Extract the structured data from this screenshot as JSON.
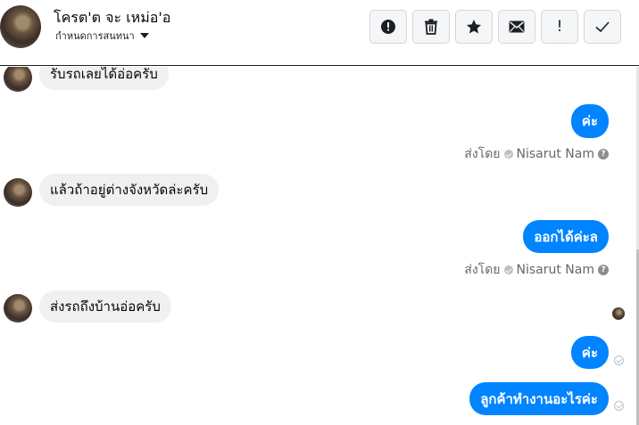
{
  "header": {
    "name": "โครต'ต จะ เหม่อ'อ",
    "subtitle": "กำหนดการสนทนา"
  },
  "toolbar": {
    "buttons": [
      {
        "name": "report-button",
        "icon": "alert-circle-icon"
      },
      {
        "name": "delete-button",
        "icon": "trash-icon"
      },
      {
        "name": "star-button",
        "icon": "star-icon"
      },
      {
        "name": "mail-button",
        "icon": "envelope-icon"
      },
      {
        "name": "mark-important-button",
        "icon": "exclamation-icon",
        "label": "!"
      },
      {
        "name": "done-button",
        "icon": "check-icon"
      }
    ]
  },
  "messages": [
    {
      "direction": "in",
      "text": "รับรถเลยได้อ่อครับ"
    },
    {
      "direction": "out",
      "text": "ค่ะ",
      "sent_by_prefix": "ส่งโดย",
      "sent_by_name": "Nisarut Nam"
    },
    {
      "direction": "in",
      "text": "แล้วถ้าอยู่ต่างจังหวัดล่ะครับ"
    },
    {
      "direction": "out",
      "text": "ออกได้ค่ะล",
      "sent_by_prefix": "ส่งโดย",
      "sent_by_name": "Nisarut Nam"
    },
    {
      "direction": "in",
      "text": "ส่งรถถึงบ้านอ่อครับ"
    },
    {
      "direction": "out",
      "text": "ค่ะ"
    },
    {
      "direction": "out",
      "text": "ลูกค้าทำงานอะไรค่ะ"
    }
  ],
  "colors": {
    "outgoing_bubble": "#0084ff",
    "incoming_bubble": "#f0f0f0",
    "meta_text": "#65676b"
  }
}
